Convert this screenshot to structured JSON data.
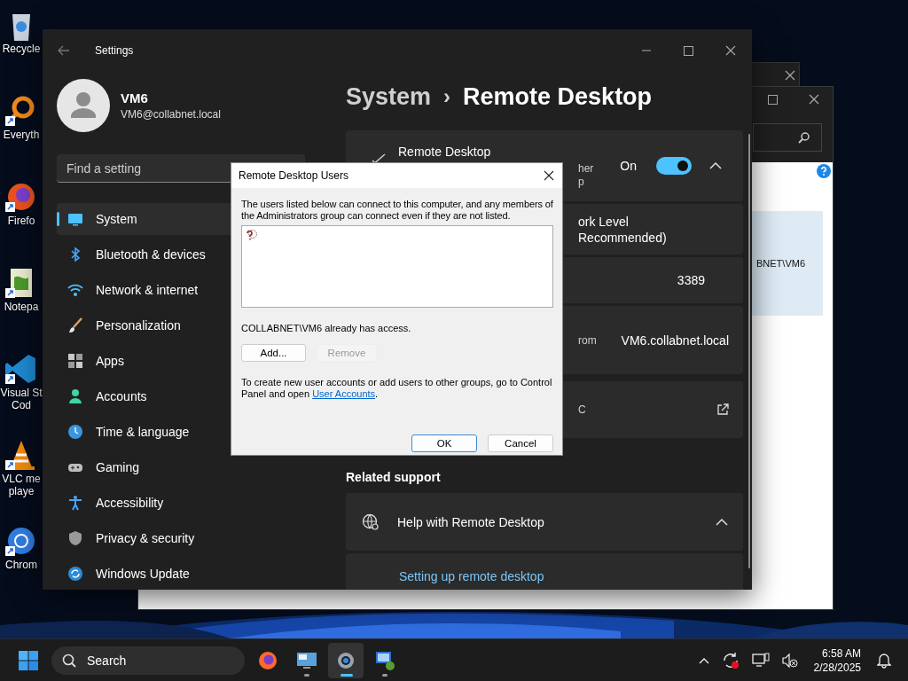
{
  "desktop": {
    "icons": [
      {
        "kind": "recycle",
        "lines": [
          "Recycle"
        ]
      },
      {
        "kind": "everything",
        "lines": [
          "Everyth"
        ]
      },
      {
        "kind": "firefox",
        "lines": [
          "Firefo"
        ]
      },
      {
        "kind": "notepad",
        "lines": [
          "Notepa"
        ]
      },
      {
        "kind": "vscode",
        "lines": [
          "Visual St",
          "Cod"
        ]
      },
      {
        "kind": "vlc",
        "lines": [
          "VLC me",
          "playe"
        ]
      },
      {
        "kind": "chrome",
        "lines": [
          "Chrom"
        ]
      }
    ]
  },
  "back_window": {
    "list_item": "BNET\\VM6"
  },
  "settings": {
    "title": "Settings",
    "user": {
      "name": "VM6",
      "email": "VM6@collabnet.local"
    },
    "search": {
      "placeholder": "Find a setting"
    },
    "nav": [
      {
        "label": "System",
        "selected": true
      },
      {
        "label": "Bluetooth & devices",
        "selected": false
      },
      {
        "label": "Network & internet",
        "selected": false
      },
      {
        "label": "Personalization",
        "selected": false
      },
      {
        "label": "Apps",
        "selected": false
      },
      {
        "label": "Accounts",
        "selected": false
      },
      {
        "label": "Time & language",
        "selected": false
      },
      {
        "label": "Gaming",
        "selected": false
      },
      {
        "label": "Accessibility",
        "selected": false
      },
      {
        "label": "Privacy & security",
        "selected": false
      },
      {
        "label": "Windows Update",
        "selected": false
      }
    ],
    "breadcrumb": {
      "parent": "System",
      "separator": "›",
      "current": "Remote Desktop"
    },
    "cards": [
      {
        "kind": "toggle",
        "title": "Remote Desktop",
        "fragments": [
          "her",
          "p"
        ],
        "state": "On",
        "on": true,
        "expanded": true
      },
      {
        "kind": "fragment",
        "lines": [
          "ork Level",
          "Recommended)"
        ]
      },
      {
        "kind": "value",
        "value": "3389"
      },
      {
        "kind": "fragment_value",
        "lines": [
          "rom"
        ],
        "value": "VM6.collabnet.local"
      },
      {
        "kind": "fragment_link",
        "lines": [
          "C"
        ]
      }
    ],
    "related": {
      "heading": "Related support",
      "help": {
        "title": "Help with Remote Desktop",
        "expanded": true
      },
      "links": [
        "Setting up remote desktop"
      ]
    }
  },
  "dialog": {
    "title": "Remote Desktop Users",
    "intro": "The users listed below can connect to this computer, and any members of the Administrators group can connect even if they are not listed.",
    "status": "COLLABNET\\VM6 already has access.",
    "buttons": [
      {
        "label": "Add...",
        "disabled": false
      },
      {
        "label": "Remove",
        "disabled": true
      }
    ],
    "note": "To create new user accounts or add users to other groups, go to Control Panel and open",
    "note_link": "User Accounts",
    "note_end": ".",
    "footer_buttons": [
      {
        "label": "OK",
        "default": true
      },
      {
        "label": "Cancel",
        "default": false
      }
    ]
  },
  "taskbar": {
    "search": {
      "label": "Search"
    },
    "apps": [
      {
        "selected": false,
        "running": false
      },
      {
        "selected": false,
        "running": true
      },
      {
        "selected": true,
        "running": true
      },
      {
        "selected": false,
        "running": true
      }
    ],
    "clock": {
      "time": "6:58 AM",
      "date": "2/28/2025"
    }
  }
}
